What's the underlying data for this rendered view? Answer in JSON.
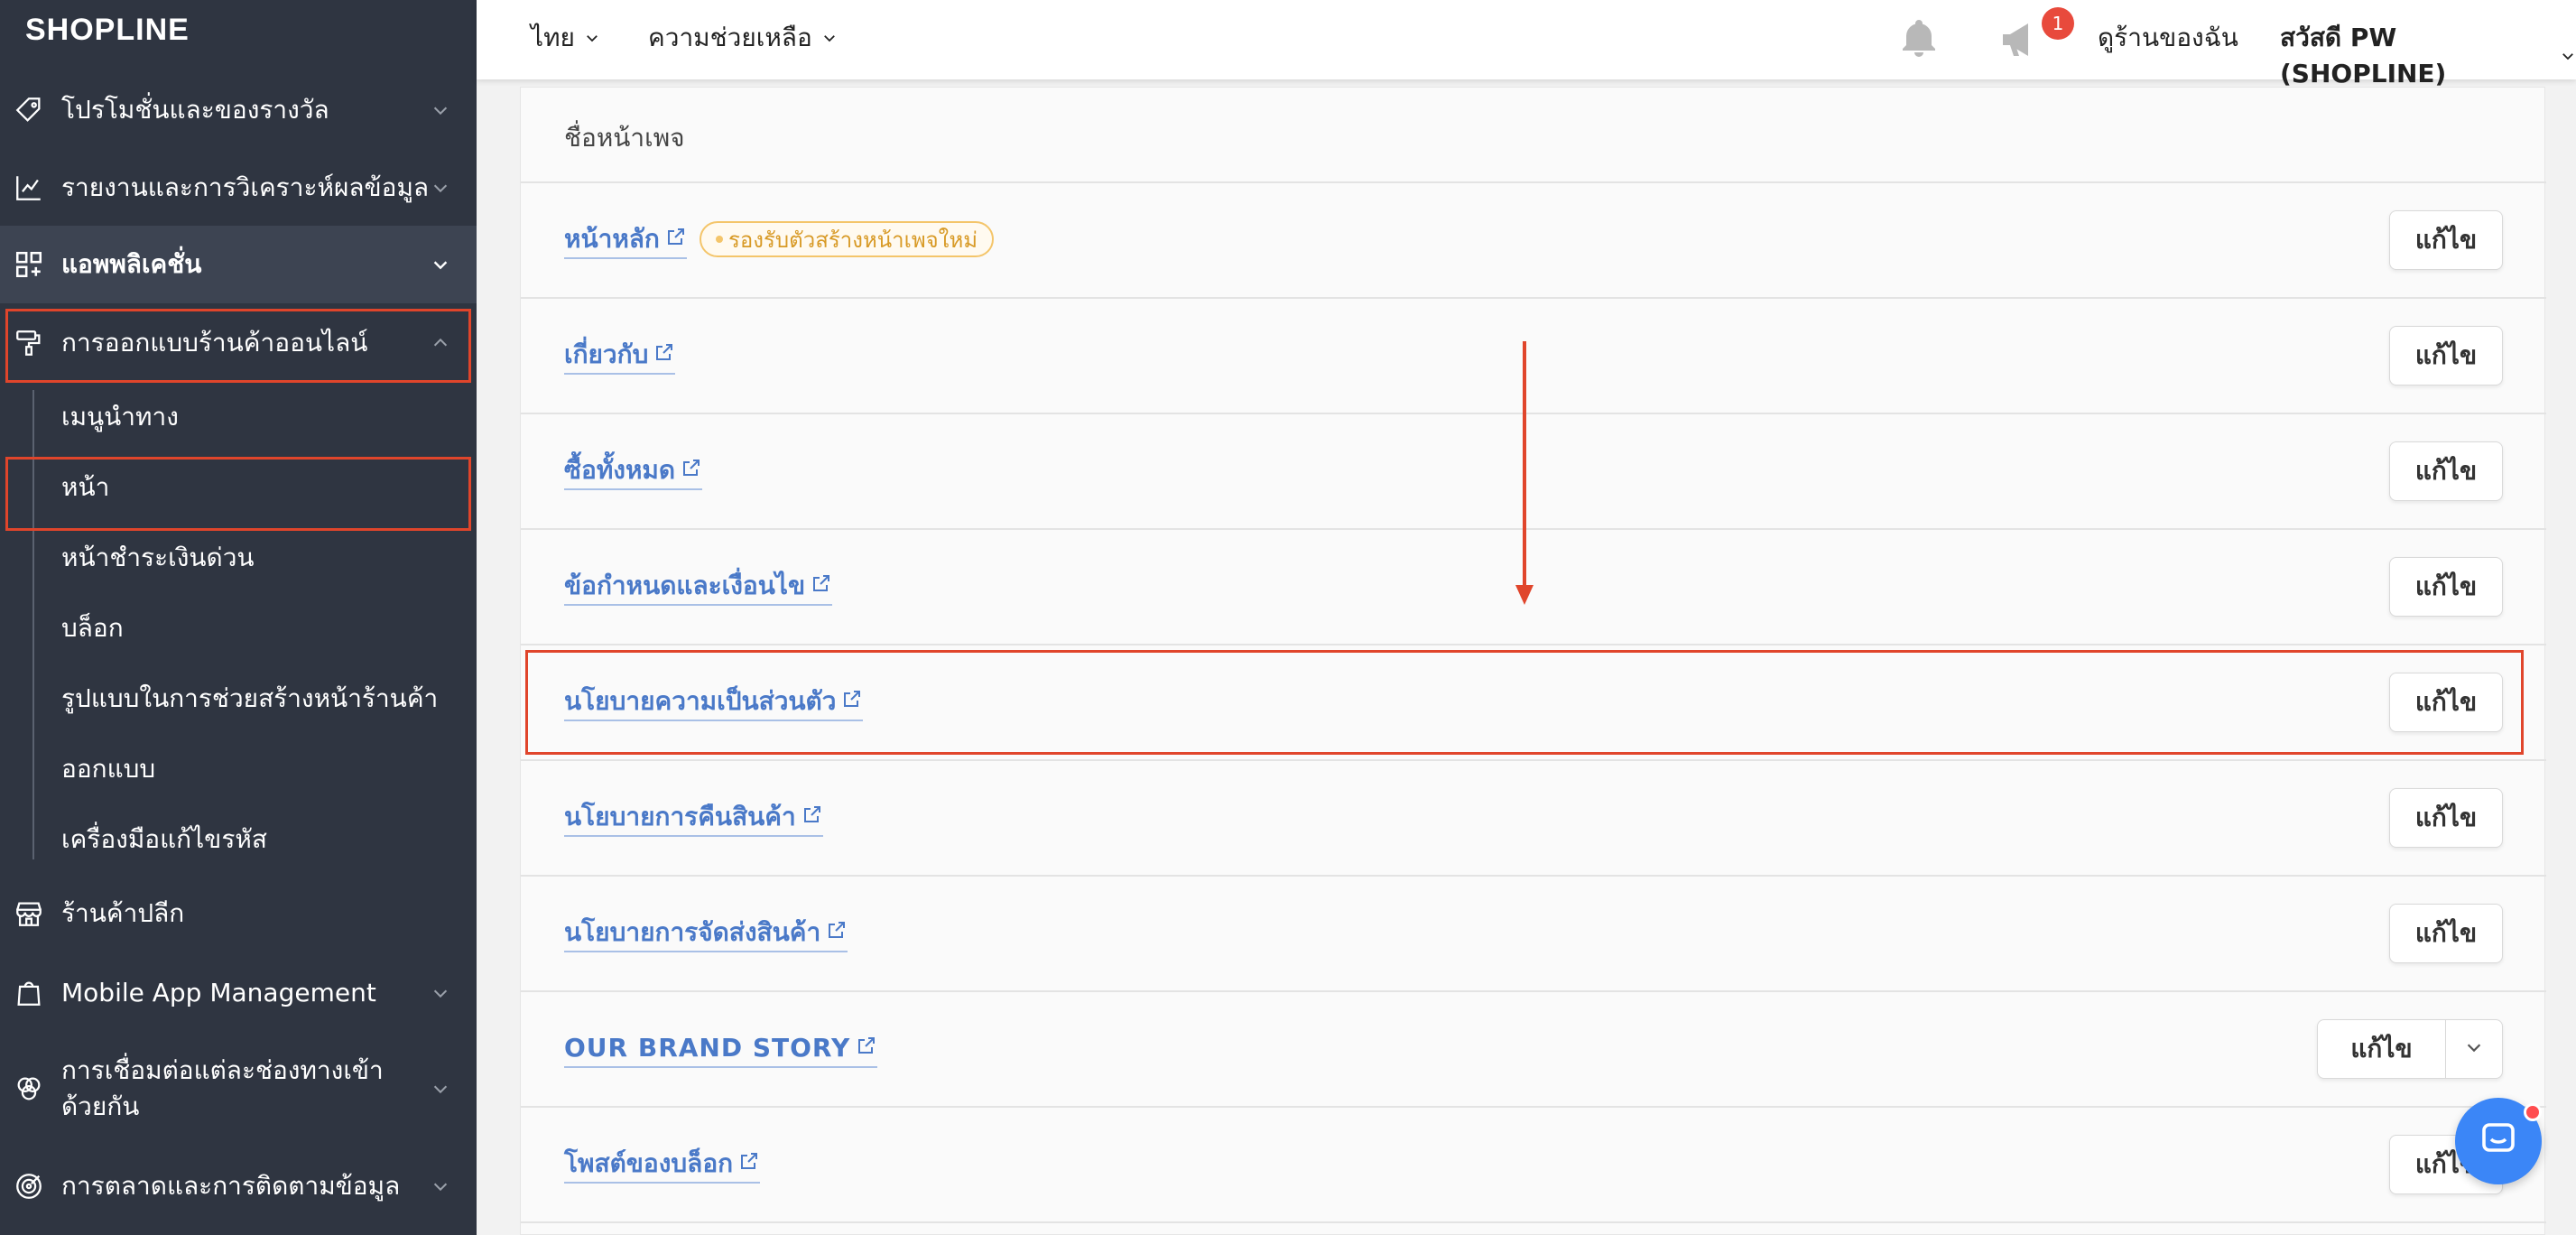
{
  "brand": {
    "logo": "SHOPLINE"
  },
  "sidebar": {
    "items": [
      {
        "label": "โปรโมชั่นและของรางวัล"
      },
      {
        "label": "รายงานและการวิเคราะห์ผลข้อมูล"
      },
      {
        "label": "แอพพลิเคชั่น"
      },
      {
        "label": "การออกแบบร้านค้าออนไลน์"
      },
      {
        "label": "ร้านค้าปลีก"
      },
      {
        "label": "Mobile App Management"
      },
      {
        "label": "การเชื่อมต่อแต่ละช่องทางเข้าด้วยกัน"
      },
      {
        "label": "การตลาดและการติดตามข้อมูล"
      }
    ],
    "subitems": [
      {
        "label": "เมนูนำทาง"
      },
      {
        "label": "หน้า"
      },
      {
        "label": "หน้าชำระเงินด่วน"
      },
      {
        "label": "บล็อก"
      },
      {
        "label": "รูปแบบในการช่วยสร้างหน้าร้านค้า"
      },
      {
        "label": "ออกแบบ"
      },
      {
        "label": "เครื่องมือแก้ไขรหัส"
      }
    ]
  },
  "topbar": {
    "language": "ไทย",
    "help": "ความช่วยเหลือ",
    "notification_count": "1",
    "view_store": "ดูร้านของฉัน",
    "greeting": "สวัสดี PW (SHOPLINE)"
  },
  "table": {
    "header": "ชื่อหน้าเพจ",
    "rows": [
      {
        "name": "หน้าหลัก",
        "tag": "รองรับตัวสร้างหน้าเพจใหม่",
        "action": "แก้ไข"
      },
      {
        "name": "เกี่ยวกับ",
        "action": "แก้ไข"
      },
      {
        "name": "ซื้อทั้งหมด",
        "action": "แก้ไข"
      },
      {
        "name": "ข้อกำหนดและเงื่อนไข",
        "action": "แก้ไข"
      },
      {
        "name": "นโยบายความเป็นส่วนตัว",
        "action": "แก้ไข"
      },
      {
        "name": "นโยบายการคืนสินค้า",
        "action": "แก้ไข"
      },
      {
        "name": "นโยบายการจัดส่งสินค้า",
        "action": "แก้ไข"
      },
      {
        "name": "OUR BRAND STORY",
        "action": "แก้ไข"
      },
      {
        "name": "โพสต์ของบล็อก",
        "action": "แก้ไข"
      }
    ]
  },
  "colors": {
    "sidebar_bg": "#2f3541",
    "link": "#4a79c8",
    "annotation": "#e0452b",
    "tag_text": "#d89a26",
    "chat": "#3b86f7"
  }
}
